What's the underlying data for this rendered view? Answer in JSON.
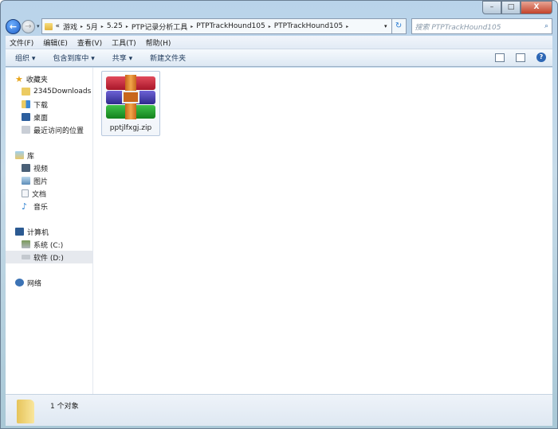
{
  "window": {
    "minimize": "–",
    "maximize": "□",
    "close": "X"
  },
  "nav": {
    "back": "←",
    "forward": "→",
    "history": "▾",
    "address_prefix": "«",
    "breadcrumb": [
      "游戏",
      "5月",
      "5.25",
      "PTP记录分析工具",
      "PTPTrackHound105",
      "PTPTrackHound105"
    ],
    "separator": "▸",
    "dropdown": "▾",
    "refresh": "↻",
    "search_placeholder": "搜索 PTPTrackHound105",
    "search_icon": "⌕"
  },
  "menu": [
    "文件(F)",
    "编辑(E)",
    "查看(V)",
    "工具(T)",
    "帮助(H)"
  ],
  "toolbar": {
    "organize": "组织 ▾",
    "include": "包含到库中 ▾",
    "share": "共享 ▾",
    "new_folder": "新建文件夹",
    "help": "?"
  },
  "sidebar": {
    "favorites": {
      "label": "收藏夹",
      "items": [
        "2345Downloads",
        "下载",
        "桌面",
        "最近访问的位置"
      ]
    },
    "libraries": {
      "label": "库",
      "items": [
        "视频",
        "图片",
        "文档",
        "音乐"
      ]
    },
    "computer": {
      "label": "计算机",
      "items": [
        "系统 (C:)",
        "软件 (D:)"
      ]
    },
    "network": {
      "label": "网络"
    }
  },
  "files": [
    {
      "name": "pptjlfxgj.zip",
      "type": "winrar-archive"
    }
  ],
  "status": {
    "count": "1 个对象"
  }
}
